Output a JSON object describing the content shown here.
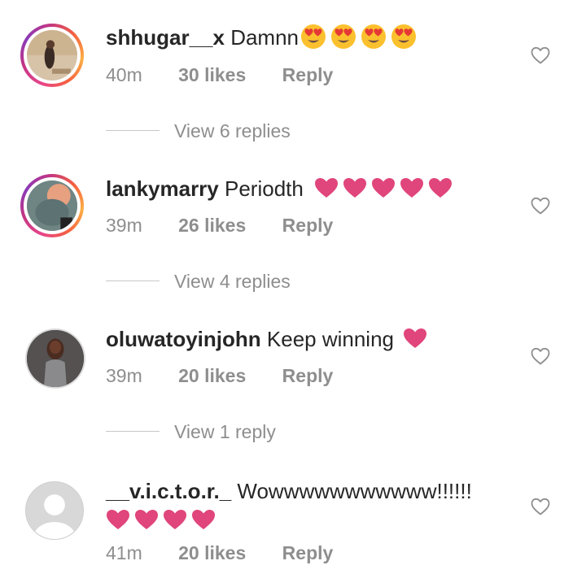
{
  "comments": [
    {
      "username": "shhugar__x",
      "text": "Damnn",
      "emojis": [
        "heart-eyes-emoji",
        "heart-eyes-emoji",
        "heart-eyes-emoji",
        "heart-eyes-emoji"
      ],
      "time": "40m",
      "likes": "30 likes",
      "reply": "Reply",
      "view_replies": "View 6 replies"
    },
    {
      "username": "lankymarry",
      "text": "Periodth",
      "emojis": [
        "pink-heart-emoji",
        "pink-heart-emoji",
        "pink-heart-emoji",
        "pink-heart-emoji",
        "pink-heart-emoji"
      ],
      "time": "39m",
      "likes": "26 likes",
      "reply": "Reply",
      "view_replies": "View 4 replies"
    },
    {
      "username": "oluwatoyinjohn",
      "text": "Keep winning",
      "emojis": [
        "pink-heart-emoji"
      ],
      "time": "39m",
      "likes": "20 likes",
      "reply": "Reply",
      "view_replies": "View 1 reply"
    },
    {
      "username": "__v.i.c.t.o.r._",
      "text": "Wowwwwwwwwwww!!!!!!",
      "emojis": [
        "pink-heart-emoji",
        "pink-heart-emoji",
        "pink-heart-emoji",
        "pink-heart-emoji"
      ],
      "time": "41m",
      "likes": "20 likes",
      "reply": "Reply"
    }
  ],
  "colors": {
    "text": "#262626",
    "meta": "#8e8e8e",
    "heart": "#e0457b",
    "emoji_face": "#fbc02d"
  },
  "icons": {
    "like": "heart-outline-icon"
  }
}
